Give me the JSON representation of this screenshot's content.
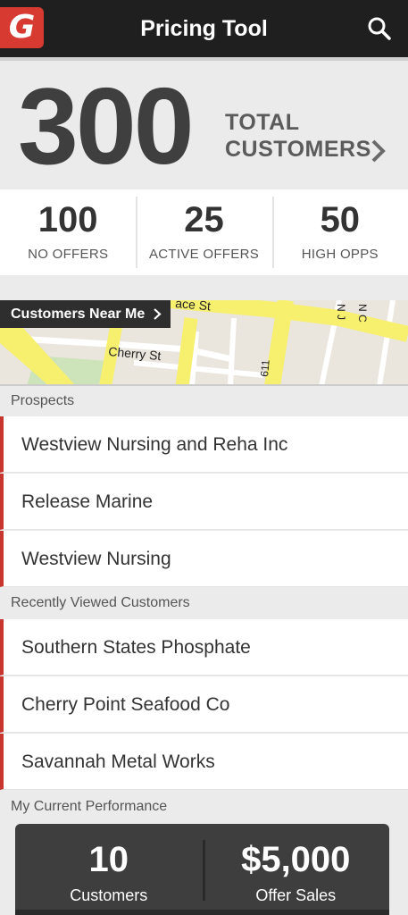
{
  "header": {
    "logo": "G",
    "title": "Pricing Tool",
    "search_icon": "search-icon"
  },
  "hero": {
    "total": "300",
    "label_line1": "TOTAL",
    "label_line2": "CUSTOMERS"
  },
  "stats": [
    {
      "value": "100",
      "label": "NO OFFERS"
    },
    {
      "value": "25",
      "label": "ACTIVE OFFERS"
    },
    {
      "value": "50",
      "label": "HIGH OPPS"
    }
  ],
  "map": {
    "button_label": "Customers Near Me",
    "street_labels": [
      "Cherry St",
      "ace St",
      "611",
      "N C",
      "N J"
    ]
  },
  "prospects": {
    "header": "Prospects",
    "items": [
      "Westview Nursing and Reha Inc",
      "Release Marine",
      "Westview Nursing"
    ]
  },
  "recent": {
    "header": "Recently Viewed Customers",
    "items": [
      "Southern States Phosphate",
      "Cherry Point Seafood Co",
      "Savannah Metal Works"
    ]
  },
  "performance": {
    "header": "My Current Performance",
    "customers_value": "10",
    "customers_label": "Customers",
    "sales_value": "$5,000",
    "sales_label": "Offer Sales"
  },
  "colors": {
    "accent": "#c8372f",
    "header_bg": "#1f1f1f",
    "panel_dark": "#3e3e3e",
    "road": "#f7ef6e"
  }
}
